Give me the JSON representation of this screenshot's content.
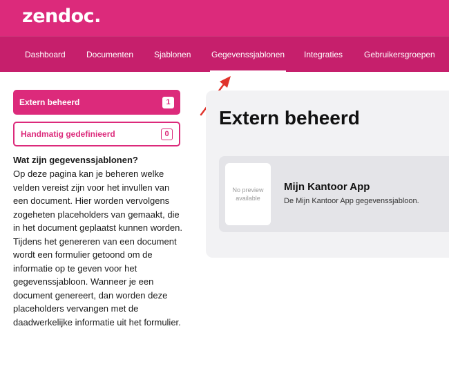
{
  "header": {
    "logo": "zendoc."
  },
  "nav": {
    "items": [
      {
        "label": "Dashboard"
      },
      {
        "label": "Documenten"
      },
      {
        "label": "Sjablonen"
      },
      {
        "label": "Gegevenssjablonen"
      },
      {
        "label": "Integraties"
      },
      {
        "label": "Gebruikersgroepen"
      }
    ],
    "active": "Gegevenssjablonen"
  },
  "sidebar": {
    "buttons": [
      {
        "label": "Extern beheerd",
        "count": "1",
        "active": true
      },
      {
        "label": "Handmatig gedefinieerd",
        "count": "0",
        "active": false
      }
    ],
    "info_title": "Wat zijn gegevenssjablonen?",
    "info_text": "Op deze pagina kan je beheren welke velden vereist zijn voor het invullen van een document. Hier worden vervolgens zogeheten placeholders van gemaakt, die in het document geplaatst kunnen worden. Tijdens het genereren van een document wordt een formulier getoond om de informatie op te geven voor het gegevenssjabloon. Wanneer je een document genereert, dan worden deze placeholders vervangen met de daadwerkelijke informatie uit het formulier."
  },
  "main": {
    "title": "Extern beheerd",
    "card": {
      "preview_text": "No preview available",
      "title": "Mijn Kantoor App",
      "description": "De Mijn Kantoor App gegevenssjabloon."
    }
  },
  "colors": {
    "brand": "#dc2a7b",
    "nav_bg": "#c61f6c",
    "arrow": "#e0342c"
  }
}
